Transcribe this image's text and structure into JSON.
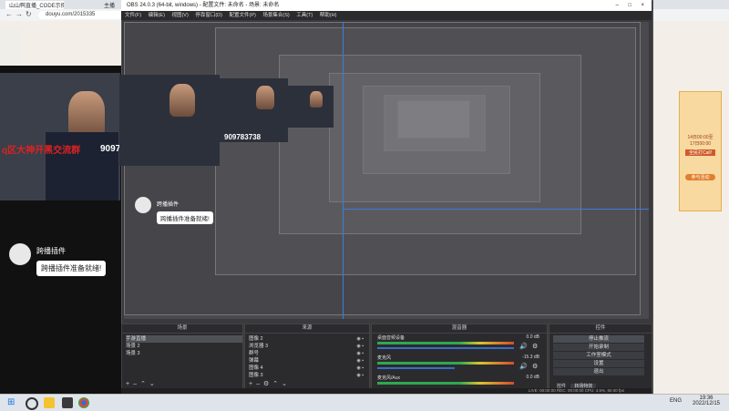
{
  "browser": {
    "tabs": [
      "山山鸭直播_CODE示例服务_6...",
      "主播",
      "",
      "",
      ""
    ],
    "address": "douyu.com/2015335"
  },
  "obs": {
    "title": "OBS 24.0.3 (64-bit, windows) - 配置文件: 未命名 - 场景: 未命名",
    "menu": [
      "文件(F)",
      "编辑(E)",
      "视图(V)",
      "停靠窗口(D)",
      "配置文件(P)",
      "场景集合(S)",
      "工具(T)",
      "帮助(H)"
    ],
    "docks": {
      "scenes": {
        "title": "场景",
        "items": [
          "手游直播",
          "场景 2",
          "场景 3"
        ]
      },
      "sources": {
        "title": "来源",
        "items": [
          "图像 2",
          "浏览器 3",
          "群号",
          "弹幕",
          "图像 4",
          "图像 3"
        ]
      },
      "mixer": {
        "title": "混音器",
        "channels": [
          {
            "name": "桌面音频设备",
            "db": "0.0 dB"
          },
          {
            "name": "麦克风",
            "db": "-15.3 dB"
          },
          {
            "name": "麦克风/Aux",
            "db": "0.0 dB"
          }
        ]
      },
      "controls": {
        "title": "控件",
        "buttons": [
          "停止推流",
          "开始录制",
          "工作室模式",
          "设置",
          "退出"
        ]
      },
      "transitions_tab": "转场特效",
      "controls_tab": "控件"
    },
    "status": "LIVE: 00:00:00    REC: 00:00:00    CPU: 4.5%, 60.00 fps"
  },
  "overlay": {
    "plugin_name": "跨播插件",
    "plugin_ready": "跨播插件准备就绪!",
    "qq_text": "q区大神开黑交流群",
    "qq_number": "909783738"
  },
  "promo": {
    "line1": "14日00:00至",
    "line2": "17日00:00",
    "line3": "全民打Call!",
    "cta": "参与活动"
  },
  "taskbar": {
    "time": "19:36",
    "date": "2022/12/15",
    "lang": "ENG"
  }
}
